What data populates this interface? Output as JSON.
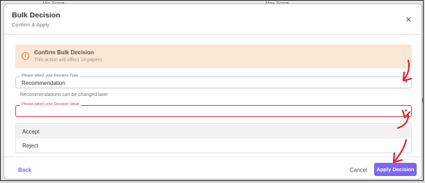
{
  "background": {
    "columns": [
      "Min Score",
      "Max Score"
    ]
  },
  "modal": {
    "title": "Bulk Decision",
    "subtitle": "Confirm & Apply",
    "close_icon": "close-icon",
    "alert": {
      "icon": "warning-icon",
      "title": "Confirm Bulk Decision",
      "description": "This action will affect 14 papers",
      "color": "#fbe7d6"
    },
    "decision_type": {
      "label": "Please select your Decision Type",
      "value": "Recommendation",
      "helper": "Recommendations can be changed later"
    },
    "decision_value": {
      "label": "Please select your Decision Value",
      "value": "",
      "options": [
        "Accept",
        "Reject"
      ]
    },
    "footer": {
      "back": "Back",
      "cancel": "Cancel",
      "apply": "Apply Decision"
    }
  },
  "colors": {
    "accent": "#7b68ee",
    "error": "#e33c3c",
    "annotation": "#e0202a"
  }
}
